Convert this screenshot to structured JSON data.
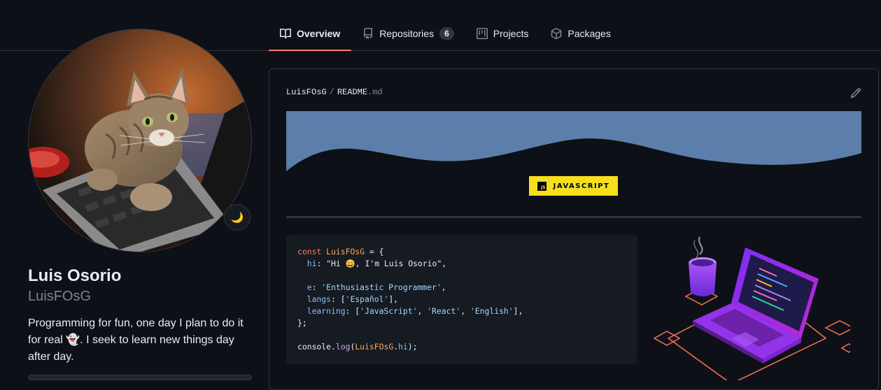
{
  "nav": {
    "tabs": [
      {
        "label": "Overview",
        "icon": "book-icon",
        "active": true
      },
      {
        "label": "Repositories",
        "icon": "repo-icon",
        "count": "6"
      },
      {
        "label": "Projects",
        "icon": "project-icon"
      },
      {
        "label": "Packages",
        "icon": "package-icon"
      }
    ]
  },
  "profile": {
    "name": "Luis Osorio",
    "login": "LuisFOsG",
    "bio_part1": "Programming for fun, one day I plan to do it for real ",
    "bio_emoji": "👻",
    "bio_part2": ". I seek to learn new things day after day.",
    "status_emoji": "🌙"
  },
  "readme": {
    "owner": "LuisFOsG",
    "separator": "/",
    "file": "README",
    "ext": ".md",
    "badge": "JAVASCRIPT",
    "badge_logo": "JS",
    "code": {
      "l1_kw": "const",
      "l1_var": "LuisFOsG",
      "l1_rest": " = {",
      "l2_prop": "hi",
      "l2_rest": ": \"Hi 😄, I'm Luis Osorio\",",
      "l3_prop": "e",
      "l3_str": "'Enthusiastic Programmer'",
      "l4_prop": "langs",
      "l4_str": "'Español'",
      "l5_prop": "learning",
      "l5_s1": "'JavaScript'",
      "l5_s2": "'React'",
      "l5_s3": "'English'",
      "l6": "};",
      "l7_obj": "console",
      "l7_fn": "log",
      "l7_var": "LuisFOsG",
      "l7_prop": "hi",
      "l7_end": ");"
    }
  },
  "colors": {
    "background": "#0d1117",
    "border": "#30363d",
    "tab_underline": "#f78166",
    "banner_wave": "#5b7faa",
    "badge": "#f7df1e"
  }
}
